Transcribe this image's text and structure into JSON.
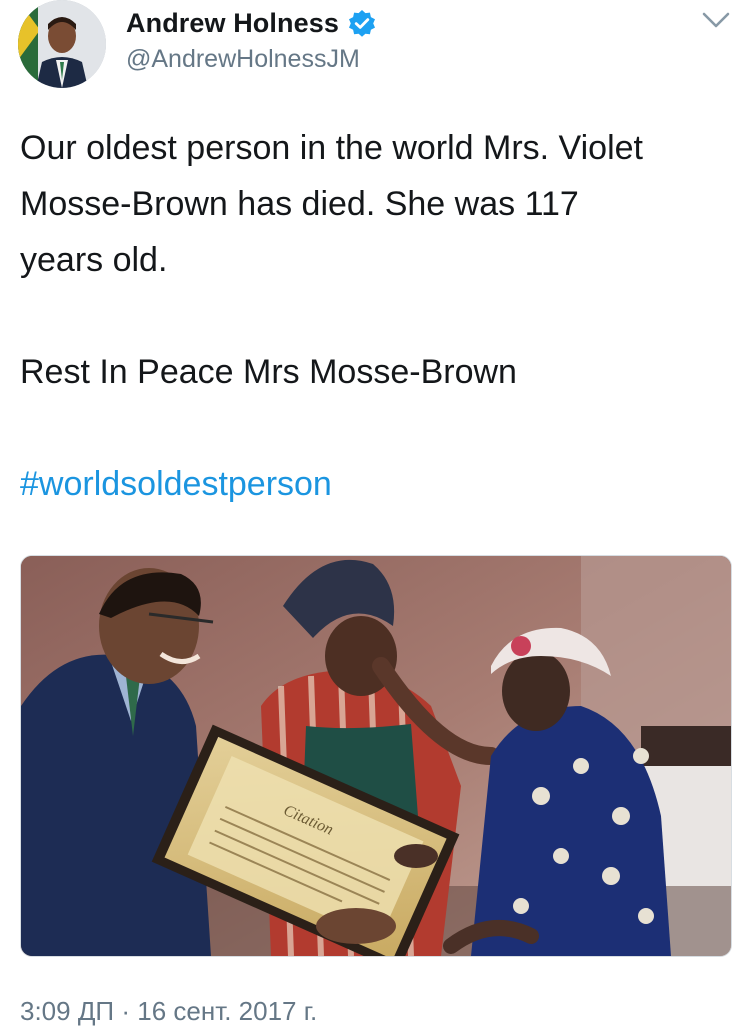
{
  "tweet": {
    "author": {
      "name": "Andrew Holness",
      "handle": "@AndrewHolnessJM",
      "verified": true,
      "avatar_icon": "profile-photo"
    },
    "menu_icon": "chevron-down-icon",
    "text_lines": [
      "Our oldest person in the world Mrs. Violet",
      "Mosse-Brown has died. She was 117",
      "years old."
    ],
    "text_second": "Rest In Peace Mrs Mosse-Brown",
    "hashtag": "#worldsoldestperson",
    "media": {
      "certificate_text": "Citation"
    },
    "timestamp": "3:09 ДП · 16 сент. 2017 г."
  },
  "colors": {
    "link": "#1b95e0",
    "verified": "#1da1f2",
    "secondary_text": "#657786",
    "primary_text": "#14171a"
  }
}
